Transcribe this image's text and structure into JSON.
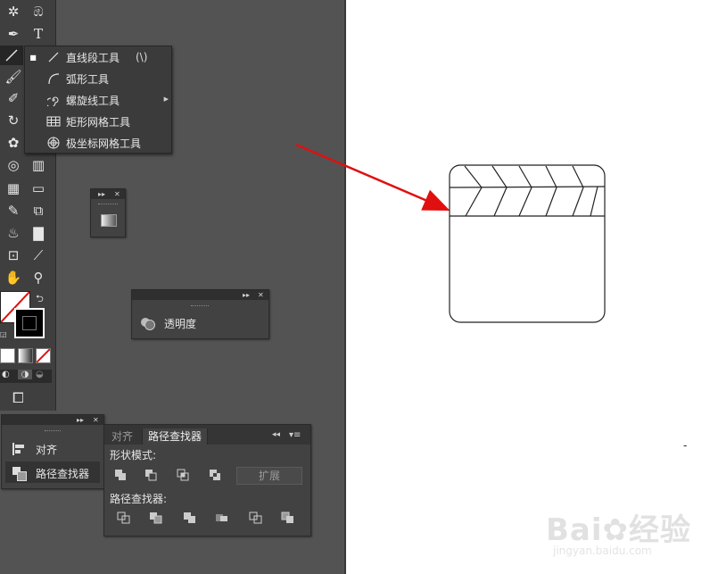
{
  "flyout": {
    "items": [
      {
        "label": "直线段工具",
        "shortcut": "(\\)",
        "icon": "line-segment-icon",
        "checked": "■"
      },
      {
        "label": "弧形工具",
        "icon": "arc-icon"
      },
      {
        "label": "螺旋线工具",
        "icon": "spiral-icon"
      },
      {
        "label": "矩形网格工具",
        "icon": "rectangular-grid-icon"
      },
      {
        "label": "极坐标网格工具",
        "icon": "polar-grid-icon"
      }
    ]
  },
  "transparency_panel": {
    "label": "透明度"
  },
  "align_panel": {
    "items": [
      "对齐",
      "路径查找器"
    ]
  },
  "pathfinder_panel": {
    "tabs": [
      "对齐",
      "路径查找器"
    ],
    "shape_modes_label": "形状模式:",
    "pathfinders_label": "路径查找器:",
    "expand_label": "扩展"
  },
  "watermark": {
    "brand": "Bai",
    "brand2": "经验",
    "url": "jingyan.baidu.com"
  },
  "canvas": {
    "mark": "-"
  },
  "colors": {
    "workspace": "#535353",
    "panel": "#424242",
    "toolbar": "#3f3f3f",
    "arrow": "#e01010",
    "flyout": "#3b3b3b"
  }
}
